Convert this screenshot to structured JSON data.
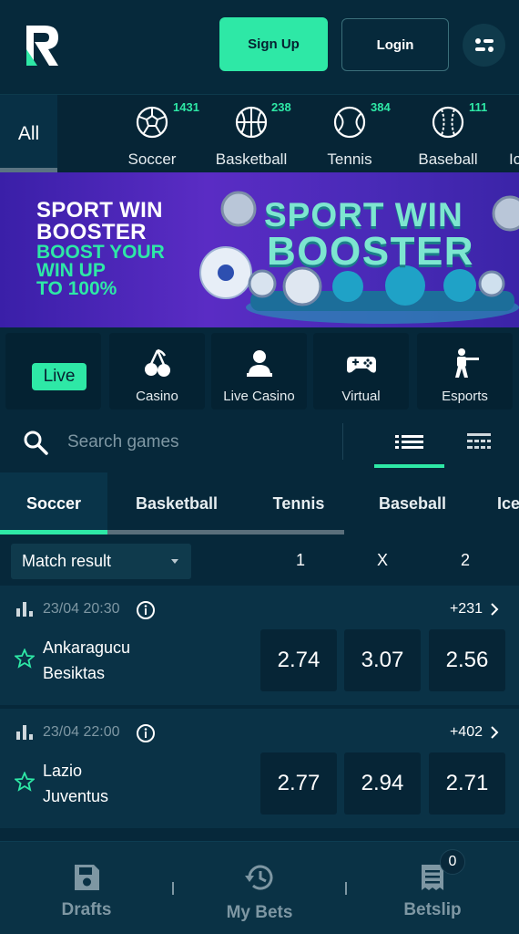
{
  "header": {
    "logo": "R",
    "signup_label": "Sign Up",
    "login_label": "Login",
    "menu_icon": "menu-dots-icon"
  },
  "sport_nav": {
    "all_label": "All",
    "items": [
      {
        "label": "Soccer",
        "count": "1431",
        "icon": "soccer-ball-icon"
      },
      {
        "label": "Basketball",
        "count": "238",
        "icon": "basketball-icon"
      },
      {
        "label": "Tennis",
        "count": "384",
        "icon": "tennis-ball-icon"
      },
      {
        "label": "Baseball",
        "count": "111",
        "icon": "baseball-icon"
      },
      {
        "label": "Ic",
        "count": "",
        "icon": ""
      }
    ]
  },
  "banner": {
    "line1": "SPORT WIN",
    "line2": "BOOSTER",
    "line3": "BOOST YOUR",
    "line4": "WIN UP",
    "line5": "TO 100%",
    "big1": "SPORT WIN",
    "big2": "BOOSTER"
  },
  "categories": [
    {
      "label": "",
      "badge": "Live",
      "icon": ""
    },
    {
      "label": "Casino",
      "icon": "cherries-icon"
    },
    {
      "label": "Live Casino",
      "icon": "dealer-icon"
    },
    {
      "label": "Virtual",
      "icon": "gamepad-icon"
    },
    {
      "label": "Esports",
      "icon": "soldier-icon"
    }
  ],
  "search": {
    "placeholder": "Search games",
    "icon": "search-icon"
  },
  "sport_tabs": [
    "Soccer",
    "Basketball",
    "Tennis",
    "Baseball",
    "Ice"
  ],
  "market": {
    "selected": "Match result",
    "col1": "1",
    "colx": "X",
    "col2": "2"
  },
  "matches": [
    {
      "time": "23/04 20:30",
      "more": "+231",
      "team1": "Ankaragucu",
      "team2": "Besiktas",
      "odd1": "2.74",
      "oddx": "3.07",
      "odd2": "2.56"
    },
    {
      "time": "23/04 22:00",
      "more": "+402",
      "team1": "Lazio",
      "team2": "Juventus",
      "odd1": "2.77",
      "oddx": "2.94",
      "odd2": "2.71"
    }
  ],
  "bottom_nav": {
    "drafts": "Drafts",
    "mybets": "My Bets",
    "betslip": "Betslip",
    "betslip_count": "0"
  },
  "colors": {
    "accent": "#2ee8a6",
    "background": "#06283a",
    "card": "#0a3246",
    "muted": "#7e97a3"
  }
}
